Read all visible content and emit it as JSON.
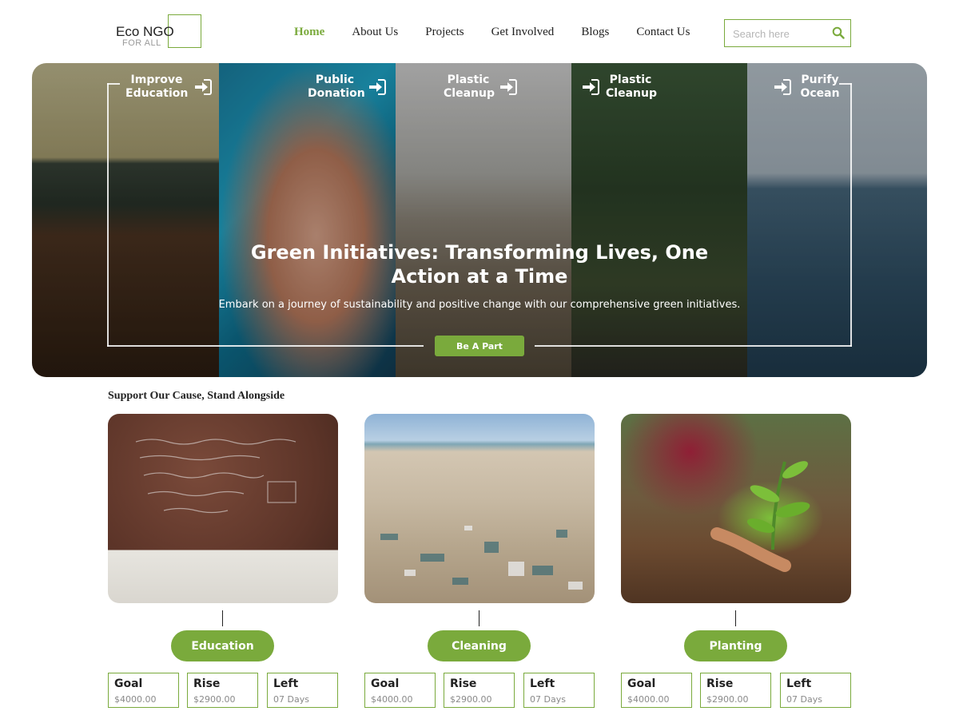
{
  "header": {
    "logo_title": "Eco NGO",
    "logo_subtitle": "FOR ALL",
    "nav": [
      {
        "label": "Home",
        "active": true
      },
      {
        "label": "About Us"
      },
      {
        "label": "Projects"
      },
      {
        "label": "Get Involved"
      },
      {
        "label": "Blogs"
      },
      {
        "label": "Contact Us"
      }
    ],
    "search": {
      "placeholder": "Search here",
      "icon": "search-icon"
    }
  },
  "hero": {
    "categories": [
      {
        "label": "Improve Education",
        "icon": "sign-in-icon"
      },
      {
        "label": "Public Donation",
        "icon": "sign-in-icon"
      },
      {
        "label": "Plastic Cleanup",
        "icon": "sign-in-icon"
      },
      {
        "label": "Plastic Cleanup",
        "icon": "sign-in-icon"
      },
      {
        "label": "Purify Ocean",
        "icon": "sign-in-icon"
      }
    ],
    "title": "Green Initiatives: Transforming Lives, One Action at a Time",
    "subtitle": "Embark on a journey of sustainability and positive change with our comprehensive green initiatives.",
    "cta": "Be A Part"
  },
  "causes": {
    "heading": "Support Our Cause, Stand Alongside",
    "items": [
      {
        "label": "Education",
        "stats": [
          {
            "label": "Goal",
            "value": "$4000.00"
          },
          {
            "label": "Rise",
            "value": "$2900.00"
          },
          {
            "label": "Left",
            "value": "07 Days"
          }
        ]
      },
      {
        "label": "Cleaning",
        "stats": [
          {
            "label": "Goal",
            "value": "$4000.00"
          },
          {
            "label": "Rise",
            "value": "$2900.00"
          },
          {
            "label": "Left",
            "value": "07 Days"
          }
        ]
      },
      {
        "label": "Planting",
        "stats": [
          {
            "label": "Goal",
            "value": "$4000.00"
          },
          {
            "label": "Rise",
            "value": "$2900.00"
          },
          {
            "label": "Left",
            "value": "07 Days"
          }
        ]
      }
    ]
  },
  "colors": {
    "accent": "#7aaa3c",
    "text": "#222222",
    "muted": "#8a8a8a"
  }
}
